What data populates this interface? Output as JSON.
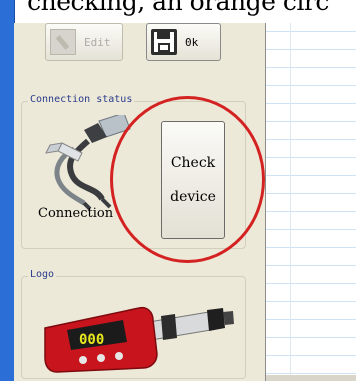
{
  "caption": {
    "text": "checking, an orange circ"
  },
  "toolbar": {
    "edit_label": "Edit",
    "ok_label": "0k"
  },
  "connection": {
    "group_title": "Connection status",
    "status_label": "Connection",
    "check_line1": "Check",
    "check_line2": "device"
  },
  "logo": {
    "group_title": "Logo",
    "display_value": "000"
  },
  "colors": {
    "sidebar_accent": "#2b6ed6",
    "highlight_circle": "#d42222",
    "device_body": "#c8141c"
  },
  "icons": [
    "edit-icon",
    "save-icon",
    "usb-cable-icon",
    "hardness-tester-icon"
  ]
}
